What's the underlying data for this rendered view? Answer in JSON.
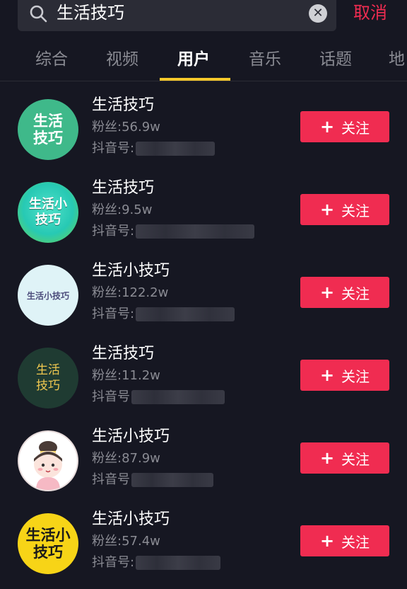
{
  "search": {
    "query": "生活技巧",
    "cancel_label": "取消"
  },
  "tabs": [
    {
      "label": "综合",
      "active": false
    },
    {
      "label": "视频",
      "active": false
    },
    {
      "label": "用户",
      "active": true
    },
    {
      "label": "音乐",
      "active": false
    },
    {
      "label": "话题",
      "active": false
    },
    {
      "label": "地",
      "active": false
    }
  ],
  "results": [
    {
      "name": "生活技巧",
      "fans": "粉丝:56.9w",
      "uid_label": "抖音号:",
      "follow_label": "关注",
      "avatar": {
        "text": "生活技巧",
        "bg": "#3fb98a",
        "fg": "#ffffff"
      }
    },
    {
      "name": "生活技巧",
      "fans": "粉丝:9.5w",
      "uid_label": "抖音号:",
      "follow_label": "关注",
      "avatar": {
        "text": "生活小技巧",
        "bg": "#27c9b4",
        "fg": "#ffffff"
      }
    },
    {
      "name": "生活小技巧",
      "fans": "粉丝:122.2w",
      "uid_label": "抖音号:",
      "follow_label": "关注",
      "avatar": {
        "text": "生活小技巧",
        "bg": "#dff3f7",
        "fg": "#4a4a7a"
      }
    },
    {
      "name": "生活技巧",
      "fans": "粉丝:11.2w",
      "uid_label": "抖音号",
      "follow_label": "关注",
      "avatar": {
        "text": "生活技巧",
        "bg": "#1f3b32",
        "fg": "#f0c850"
      }
    },
    {
      "name": "生活小技巧",
      "fans": "粉丝:87.9w",
      "uid_label": "抖音号",
      "follow_label": "关注",
      "avatar": {
        "text": "",
        "bg": "#ffffff",
        "fg": "#333333"
      }
    },
    {
      "name": "生活小技巧",
      "fans": "粉丝:57.4w",
      "uid_label": "抖音号:",
      "follow_label": "关注",
      "avatar": {
        "text": "生活小技巧",
        "bg": "#f7d417",
        "fg": "#1a1a1a"
      }
    }
  ]
}
